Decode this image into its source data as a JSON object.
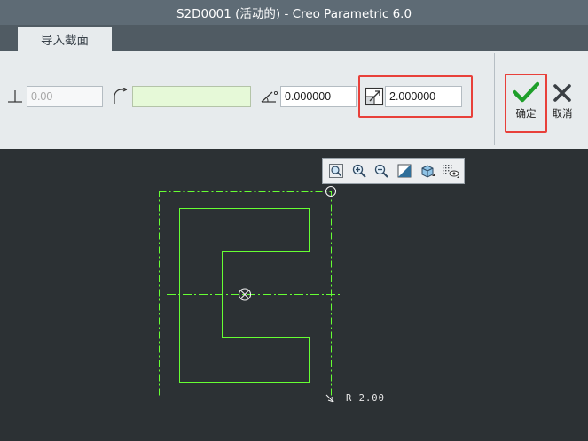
{
  "window": {
    "title": "S2D0001 (活动的) - Creo Parametric 6.0"
  },
  "tabs": [
    {
      "label": "导入截面",
      "active": true
    }
  ],
  "ribbon": {
    "fields": [
      {
        "name": "perpendicular",
        "icon": "perpendicular-icon",
        "value": "0.00",
        "enabled": false
      },
      {
        "name": "reference",
        "icon": "arc-corner-icon",
        "value": ""
      },
      {
        "name": "rotation-angle",
        "icon": "angle-icon",
        "value": "0.000000"
      },
      {
        "name": "scale",
        "icon": "scale-icon",
        "value": "2.000000",
        "highlighted": true
      }
    ],
    "ok_label": "确定",
    "cancel_label": "取消"
  },
  "mini_toolbar": {
    "icons": [
      "zoom-fit-icon",
      "zoom-in-icon",
      "zoom-out-icon",
      "repaint-icon",
      "display-style-icon",
      "sketch-display-filter-icon"
    ]
  },
  "canvas": {
    "dimension_label": "R 2.00"
  },
  "colors": {
    "canvas_bg": "#2c3134",
    "geometry": "#66ff33",
    "highlight": "#e8403a",
    "confirm": "#1e9f2a"
  }
}
